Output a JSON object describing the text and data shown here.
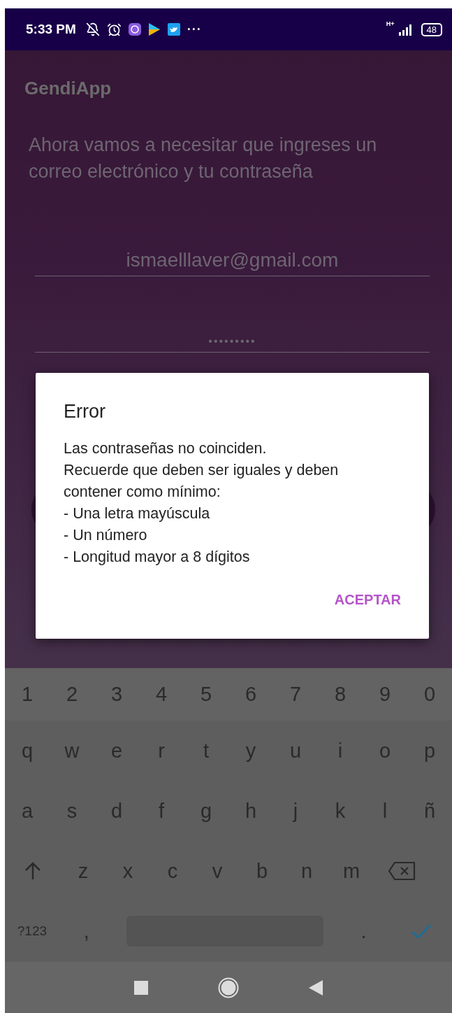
{
  "status_bar": {
    "time": "5:33 PM",
    "more": "···",
    "network": "H+",
    "battery": "48"
  },
  "app_bar": {
    "title": "GendiApp"
  },
  "prompt": "Ahora vamos a necesitar que ingreses un correo electrónico y tu contraseña",
  "email_field": {
    "value": "ismaelllaver@gmail.com"
  },
  "password_field": {
    "value": "•••••••••"
  },
  "dialog": {
    "title": "Error",
    "message": "Las contraseñas no coinciden.\n Recuerde que deben ser iguales y deben contener como mínimo:\n - Una letra mayúscula\n - Un número\n - Longitud mayor a 8 dígitos",
    "button": "ACEPTAR"
  },
  "keyboard": {
    "rows": [
      [
        {
          "kind": "char",
          "label": "1"
        },
        {
          "kind": "char",
          "label": "2"
        },
        {
          "kind": "char",
          "label": "3"
        },
        {
          "kind": "char",
          "label": "4"
        },
        {
          "kind": "char",
          "label": "5"
        },
        {
          "kind": "char",
          "label": "6"
        },
        {
          "kind": "char",
          "label": "7"
        },
        {
          "kind": "char",
          "label": "8"
        },
        {
          "kind": "char",
          "label": "9"
        },
        {
          "kind": "char",
          "label": "0"
        }
      ],
      [
        {
          "kind": "char",
          "label": "q"
        },
        {
          "kind": "char",
          "label": "w"
        },
        {
          "kind": "char",
          "label": "e"
        },
        {
          "kind": "char",
          "label": "r"
        },
        {
          "kind": "char",
          "label": "t"
        },
        {
          "kind": "char",
          "label": "y"
        },
        {
          "kind": "char",
          "label": "u"
        },
        {
          "kind": "char",
          "label": "i"
        },
        {
          "kind": "char",
          "label": "o"
        },
        {
          "kind": "char",
          "label": "p"
        }
      ],
      [
        {
          "kind": "char",
          "label": "a"
        },
        {
          "kind": "char",
          "label": "s"
        },
        {
          "kind": "char",
          "label": "d"
        },
        {
          "kind": "char",
          "label": "f"
        },
        {
          "kind": "char",
          "label": "g"
        },
        {
          "kind": "char",
          "label": "h"
        },
        {
          "kind": "char",
          "label": "j"
        },
        {
          "kind": "char",
          "label": "k"
        },
        {
          "kind": "char",
          "label": "l"
        },
        {
          "kind": "char",
          "label": "ñ"
        }
      ],
      [
        {
          "kind": "shift"
        },
        {
          "kind": "char",
          "label": "z"
        },
        {
          "kind": "char",
          "label": "x"
        },
        {
          "kind": "char",
          "label": "c"
        },
        {
          "kind": "char",
          "label": "v"
        },
        {
          "kind": "char",
          "label": "b"
        },
        {
          "kind": "char",
          "label": "n"
        },
        {
          "kind": "char",
          "label": "m"
        },
        {
          "kind": "backspace"
        }
      ],
      [
        {
          "kind": "mode",
          "label": "?123"
        },
        {
          "kind": "char",
          "label": ","
        },
        {
          "kind": "space"
        },
        {
          "kind": "char",
          "label": "."
        },
        {
          "kind": "done"
        }
      ]
    ]
  }
}
